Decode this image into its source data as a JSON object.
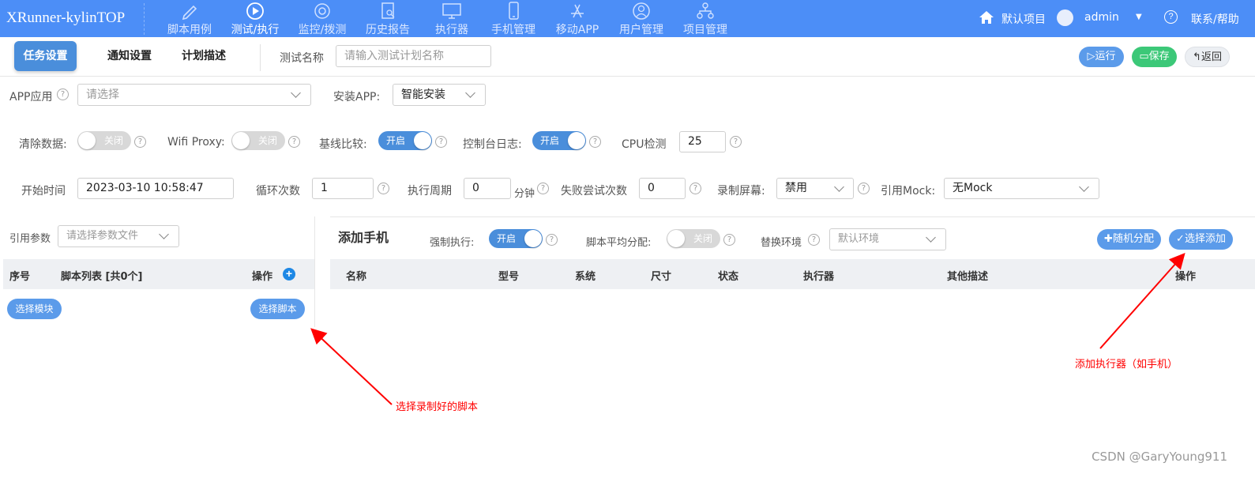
{
  "app": {
    "brand": "XRunner-kylinTOP"
  },
  "nav": {
    "items": [
      {
        "label": "脚本用例",
        "icon": "pencil-icon"
      },
      {
        "label": "测试/执行",
        "icon": "play-circle-icon"
      },
      {
        "label": "监控/拨测",
        "icon": "monitor-icon"
      },
      {
        "label": "历史报告",
        "icon": "report-icon"
      },
      {
        "label": "执行器",
        "icon": "desktop-icon"
      },
      {
        "label": "手机管理",
        "icon": "mobile-icon"
      },
      {
        "label": "移动APP",
        "icon": "app-store-icon"
      },
      {
        "label": "用户管理",
        "icon": "user-icon"
      },
      {
        "label": "项目管理",
        "icon": "sitemap-icon"
      }
    ],
    "active_index": 1,
    "project": "默认项目",
    "user": "admin",
    "help": "联系/帮助"
  },
  "tabs": {
    "items": [
      "任务设置",
      "通知设置",
      "计划描述"
    ],
    "active_index": 0
  },
  "plan_name": {
    "label": "测试名称",
    "placeholder": "请输入测试计划名称"
  },
  "actions": {
    "run": "运行",
    "save": "保存",
    "back": "返回",
    "colors": {
      "run": "#5b9bea",
      "save": "#3cc878",
      "back": "#eceff3"
    }
  },
  "app_row": {
    "app_label": "APP应用",
    "app_placeholder": "请选择",
    "install_label": "安装APP:",
    "install_value": "智能安装"
  },
  "switch_row": {
    "clear_data": {
      "label": "清除数据:",
      "state": "关闭"
    },
    "wifi_proxy": {
      "label": "Wifi Proxy:",
      "state": "关闭"
    },
    "baseline": {
      "label": "基线比较:",
      "state": "开启"
    },
    "console_log": {
      "label": "控制台日志:",
      "state": "开启"
    },
    "cpu": {
      "label": "CPU检测",
      "value": "25"
    }
  },
  "schedule_row": {
    "start_time_label": "开始时间",
    "start_time_value": "2023-03-10 10:58:47",
    "loops_label": "循环次数",
    "loops_value": "1",
    "period_label": "执行周期",
    "period_value": "0",
    "period_unit": "分钟",
    "retry_label": "失败尝试次数",
    "retry_value": "0",
    "record_label": "录制屏幕:",
    "record_value": "禁用",
    "mock_label": "引用Mock:",
    "mock_value": "无Mock"
  },
  "scripts_panel": {
    "param_label": "引用参数",
    "param_placeholder": "请选择参数文件",
    "columns": [
      "序号",
      "脚本列表 [共0个]",
      "操作"
    ],
    "select_module": "选择模块",
    "select_script": "选择脚本"
  },
  "phones_panel": {
    "title": "添加手机",
    "force_exec": {
      "label": "强制执行:",
      "state": "开启"
    },
    "avg_assign": {
      "label": "脚本平均分配:",
      "state": "关闭"
    },
    "env_label": "替换环境",
    "env_placeholder": "默认环境",
    "random_btn": "随机分配",
    "select_add_btn": "选择添加",
    "columns": [
      "名称",
      "型号",
      "系统",
      "尺寸",
      "状态",
      "执行器",
      "其他描述",
      "操作"
    ]
  },
  "annotations": {
    "script_note": "选择录制好的脚本",
    "executor_note": "添加执行器（如手机）",
    "color": "#ff0000"
  },
  "watermark": "CSDN @GaryYoung911"
}
